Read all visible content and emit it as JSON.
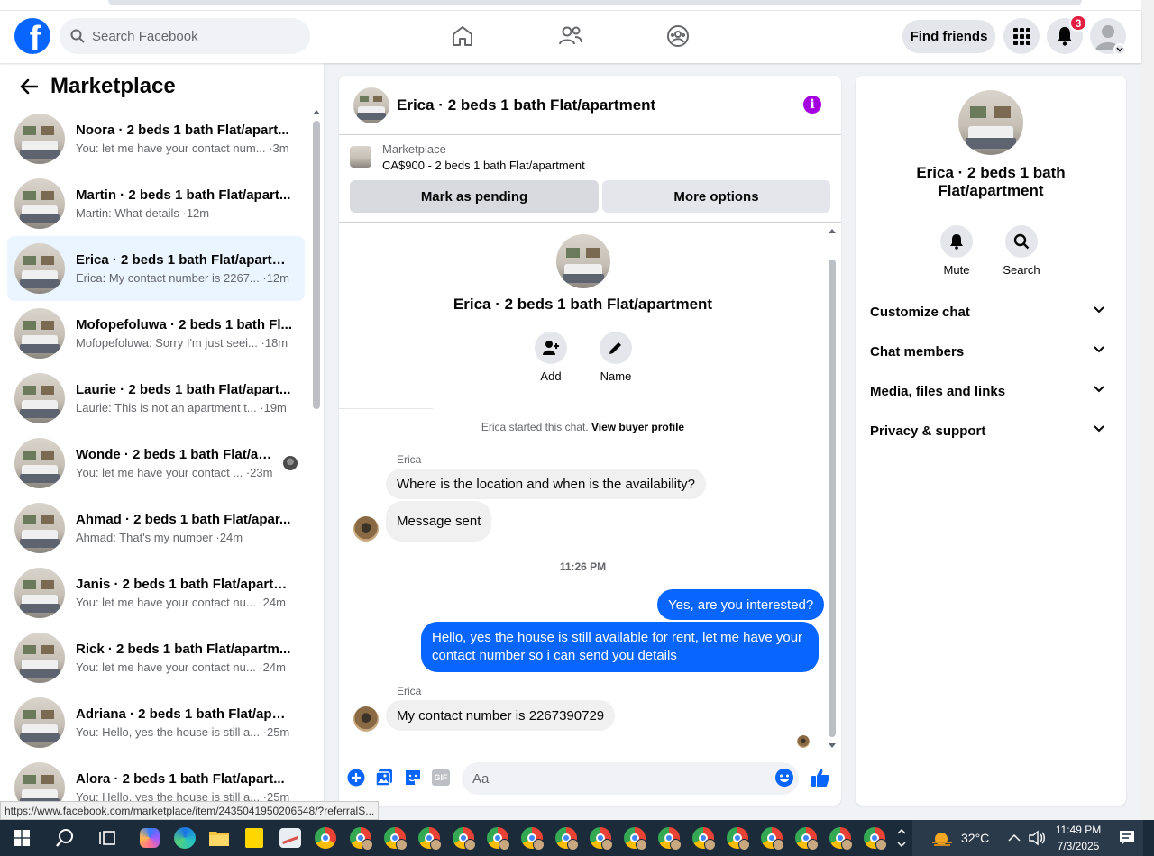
{
  "header": {
    "logo": "f",
    "search_placeholder": "Search Facebook",
    "find_friends_label": "Find friends",
    "notification_count": "3"
  },
  "sidebar": {
    "title": "Marketplace",
    "conversations": [
      {
        "title": "Noora · 2 beds 1 bath Flat/apart...",
        "subtitle": "You: let me have your contact num... ·3m"
      },
      {
        "title": "Martin · 2 beds 1 bath Flat/apart...",
        "subtitle": "Martin: What details ·12m"
      },
      {
        "title": "Erica · 2 beds 1 bath Flat/apartm...",
        "subtitle": "Erica: My contact number is 2267... ·12m"
      },
      {
        "title": "Mofopefoluwa · 2 beds 1 bath Fl...",
        "subtitle": "Mofopefoluwa: Sorry I'm just seei... ·18m"
      },
      {
        "title": "Laurie · 2 beds 1 bath Flat/apart...",
        "subtitle": "Laurie: This is not an apartment t... ·19m"
      },
      {
        "title": "Wonde · 2 beds 1 bath Flat/ap...",
        "subtitle": "You: let me have your contact ... ·23m"
      },
      {
        "title": "Ahmad · 2 beds 1 bath Flat/apar...",
        "subtitle": "Ahmad: That's my number ·24m"
      },
      {
        "title": "Janis · 2 beds 1 bath Flat/apartm...",
        "subtitle": "You: let me have your contact nu... ·24m"
      },
      {
        "title": "Rick · 2 beds 1 bath Flat/apartm...",
        "subtitle": "You: let me have your contact nu... ·24m"
      },
      {
        "title": "Adriana · 2 beds 1 bath Flat/apar...",
        "subtitle": "You: Hello, yes the house is still a... ·25m"
      },
      {
        "title": "Alora · 2 beds 1 bath Flat/apart...",
        "subtitle": "You: Hello, yes the house is still a... ·25m"
      }
    ]
  },
  "chat": {
    "title": "Erica · 2 beds 1 bath Flat/apartment",
    "listing_label": "Marketplace",
    "listing_price": "CA$900 - 2 beds 1 bath Flat/apartment",
    "mark_pending_label": "Mark as pending",
    "more_options_label": "More options",
    "intro_title": "Erica · 2 beds 1 bath Flat/apartment",
    "add_label": "Add",
    "name_label": "Name",
    "started_text": "Erica started this chat.",
    "view_profile_label": "View buyer profile",
    "sender_1": "Erica",
    "msg_1": "Where is the location and when is the availability?",
    "msg_2": "Message sent",
    "time_label": "11:26 PM",
    "msg_3": "Yes, are you interested?",
    "msg_4": "Hello, yes the house is still available for rent, let me have your contact number so i can send you details",
    "sender_2": "Erica",
    "msg_5": "My contact number is 2267390729",
    "input_placeholder": "Aa",
    "gif_label": "GIF"
  },
  "details": {
    "title": "Erica · 2 beds 1 bath Flat/apartment",
    "mute_label": "Mute",
    "search_label": "Search",
    "sections": [
      "Customize chat",
      "Chat members",
      "Media, files and links",
      "Privacy & support"
    ]
  },
  "status_url": "https://www.facebook.com/marketplace/item/2435041950206548/?referralS...",
  "taskbar": {
    "temperature": "32°C",
    "time": "11:49 PM",
    "date": "7/3/2025"
  },
  "colors": {
    "brand": "#0866ff",
    "outgoing_bubble": "#0866ff",
    "info_icon": "#a400e0",
    "badge": "#e41e3f",
    "active_conversation": "#ebf5ff"
  }
}
